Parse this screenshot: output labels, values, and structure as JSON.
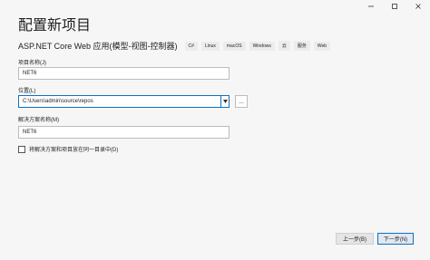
{
  "window": {
    "controls": [
      "minimize-icon",
      "maximize-icon",
      "close-icon"
    ]
  },
  "page": {
    "title": "配置新项目"
  },
  "template": {
    "name": "ASP.NET Core Web 应用(模型-视图-控制器)",
    "tags": [
      "C#",
      "Linux",
      "macOS",
      "Windows",
      "云",
      "服务",
      "Web"
    ]
  },
  "project_name": {
    "label": "项目名称(J)",
    "value": "NET6"
  },
  "location": {
    "label": "位置(L)",
    "value": "C:\\Users\\admin\\source\\repos",
    "browse_label": "..."
  },
  "solution_name": {
    "label": "解决方案名称(M)",
    "value": "NET6"
  },
  "same_dir": {
    "label": "将解决方案和项目放在同一目录中(D)",
    "checked": false
  },
  "footer": {
    "back_label": "上一步(B)",
    "next_label": "下一步(N)"
  },
  "colors": {
    "accent": "#0e70c0",
    "background": "#f6f6f6"
  }
}
